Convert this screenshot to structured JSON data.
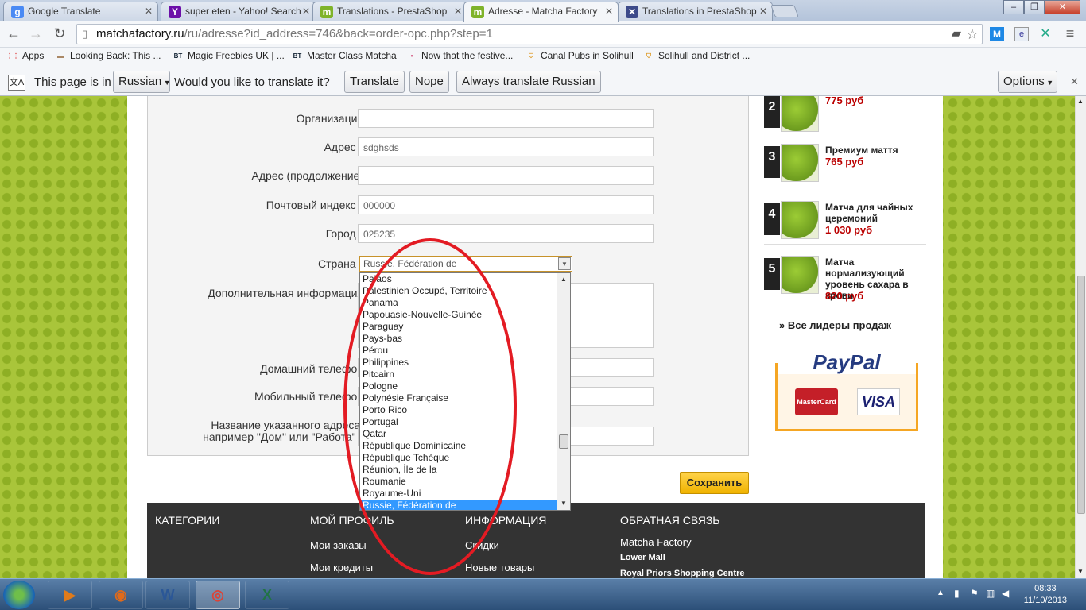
{
  "browser": {
    "tabs": [
      {
        "title": "Google Translate",
        "icon": "google-translate-icon",
        "color": "#4a8af4",
        "glyph": "g"
      },
      {
        "title": "super eten - Yahoo! Search",
        "icon": "yahoo-icon",
        "color": "#6b0fa8",
        "glyph": "Y"
      },
      {
        "title": "Translations - PrestaShop",
        "icon": "matcha-icon",
        "color": "#7fb32a",
        "glyph": "m"
      },
      {
        "title": "Adresse - Matcha Factory",
        "icon": "matcha-icon",
        "color": "#7fb32a",
        "glyph": "m"
      },
      {
        "title": "Translations in PrestaShop",
        "icon": "prestashop-icon",
        "color": "#3c4a8a",
        "glyph": "✕"
      }
    ],
    "url_host": "matchafactory.ru",
    "url_path": "/ru/adresse?id_address=746&back=order-opc.php?step=1",
    "bookmarks": [
      {
        "label": "Apps",
        "icon": "apps-icon"
      },
      {
        "label": "Looking Back: This ...",
        "icon": "bookmark-icon"
      },
      {
        "label": "Magic Freebies UK | ...",
        "icon": "bt-icon"
      },
      {
        "label": "Master Class Matcha",
        "icon": "bt-icon"
      },
      {
        "label": "Now that the festive...",
        "icon": "bookmark-icon"
      },
      {
        "label": "Canal Pubs in Solihull",
        "icon": "pub-icon"
      },
      {
        "label": "Solihull and District ...",
        "icon": "pub-icon"
      }
    ],
    "translate_bar": {
      "prefix": "This page is in",
      "language": "Russian",
      "question": "Would you like to translate it?",
      "translate": "Translate",
      "nope": "Nope",
      "always": "Always translate Russian",
      "options": "Options"
    }
  },
  "form": {
    "fields": [
      {
        "label": "Организация",
        "required": false,
        "value": ""
      },
      {
        "label": "Адрес",
        "required": true,
        "value": "sdghsds"
      },
      {
        "label": "Адрес (продолжение)",
        "required": false,
        "value": ""
      },
      {
        "label": "Почтовый индекс",
        "required": true,
        "value": "000000"
      },
      {
        "label": "Город",
        "required": true,
        "value": "025235"
      }
    ],
    "country_label": "Страна",
    "country_value": "Russie, Fédération de",
    "extra_label": "Дополнительная информация",
    "home_phone_label": "Домашний телефон",
    "mobile_phone_label": "Мобильный телефон",
    "alias_label_1": "Название указанного адреса,",
    "alias_label_2": "например \"Дом\" или \"Работа\"",
    "required_mark": "*",
    "save_button": "Сохранить"
  },
  "country_dropdown": {
    "options": [
      "Palaos",
      "Palestinien Occupé, Territoire",
      "Panama",
      "Papouasie-Nouvelle-Guinée",
      "Paraguay",
      "Pays-bas",
      "Pérou",
      "Philippines",
      "Pitcairn",
      "Pologne",
      "Polynésie Française",
      "Porto Rico",
      "Portugal",
      "Qatar",
      "République Dominicaine",
      "République Tchèque",
      "Réunion, Île de la",
      "Roumanie",
      "Royaume-Uni",
      "Russie, Fédération de"
    ],
    "selected": "Russie, Fédération de"
  },
  "sidebar": {
    "products": [
      {
        "rank": "2",
        "name": "",
        "price": "775 руб"
      },
      {
        "rank": "3",
        "name": "Премиум маття",
        "price": "765 руб"
      },
      {
        "rank": "4",
        "name": "Матча для чайных церемоний",
        "price": "1 030 руб"
      },
      {
        "rank": "5",
        "name": "Матча нормализующий уровень сахара в крови",
        "price": "820 руб"
      }
    ],
    "all_leaders": "» Все лидеры продаж",
    "paypal": "PayPal",
    "mastercard": "MasterCard",
    "visa": "VISA"
  },
  "footer": {
    "columns": [
      {
        "heading": "КАТЕГОРИИ",
        "links": []
      },
      {
        "heading": "МОЙ ПРОФИЛЬ",
        "links": [
          "Мои заказы",
          "Мои кредиты"
        ]
      },
      {
        "heading": "ИНФОРМАЦИЯ",
        "links": [
          "Скидки",
          "Новые товары"
        ]
      },
      {
        "heading": "ОБРАТНАЯ СВЯЗЬ",
        "links": [
          "Matcha Factory",
          "Lower Mall",
          "Royal Priors Shopping Centre"
        ]
      }
    ]
  },
  "taskbar": {
    "apps": [
      {
        "name": "media-player",
        "glyph": "▶",
        "color": "#e07b1a"
      },
      {
        "name": "firefox",
        "glyph": "◉",
        "color": "#e06a1a"
      },
      {
        "name": "word",
        "glyph": "W",
        "color": "#2b5797"
      },
      {
        "name": "chrome",
        "glyph": "◎",
        "color": "#db4437"
      },
      {
        "name": "excel",
        "glyph": "X",
        "color": "#217346"
      }
    ],
    "time": "08:33",
    "date": "11/10/2013"
  }
}
